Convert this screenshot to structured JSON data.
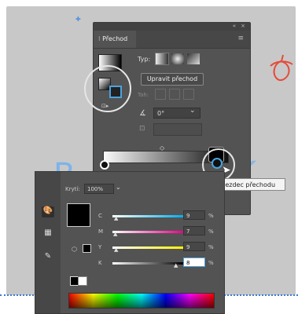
{
  "gradient_panel": {
    "tab_title": "Přechod",
    "collapse_icon": "double-chevron-icon",
    "close_icon": "close-icon",
    "menu_icon": "hamburger-menu-icon",
    "typ_label": "Typ:",
    "edit_button_label": "Upravit přechod",
    "tah_label": "Tah:",
    "angle_value": "0°",
    "angle_icon": "angle-icon",
    "ratio_icon": "aspect-ratio-icon"
  },
  "tooltip": {
    "text": "Jezdec přechodu"
  },
  "color_panel": {
    "opacity_label": "Krytí:",
    "opacity_value": "100%",
    "channels": [
      {
        "label": "C",
        "value": "9",
        "unit": "%"
      },
      {
        "label": "M",
        "value": "7",
        "unit": "%"
      },
      {
        "label": "Y",
        "value": "9",
        "unit": "%"
      },
      {
        "label": "K",
        "value": "8",
        "unit": "%"
      }
    ],
    "side_icons": [
      "color-palette-icon",
      "swatches-grid-icon",
      "eyedropper-icon"
    ]
  }
}
